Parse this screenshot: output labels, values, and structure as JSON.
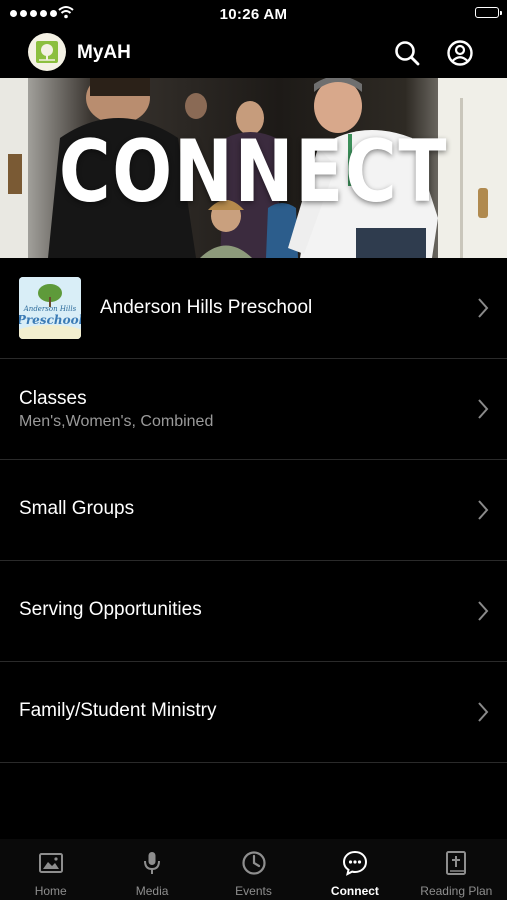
{
  "status_bar": {
    "time": "10:26 AM"
  },
  "nav": {
    "title": "MyAH",
    "logo_icon": "tree-logo-icon",
    "search_icon": "search-icon",
    "account_icon": "account-circle-icon"
  },
  "hero": {
    "title": "CONNECT"
  },
  "list": {
    "items": [
      {
        "title": "Anderson Hills Preschool",
        "thumbnail": "preschool-logo",
        "thumbnail_text": "Anderson Hills",
        "thumbnail_script": "Preschool"
      },
      {
        "title": "Classes",
        "subtitle": "Men's,Women's, Combined"
      },
      {
        "title": "Small Groups"
      },
      {
        "title": "Serving Opportunities"
      },
      {
        "title": "Family/Student Ministry"
      }
    ]
  },
  "tabs": [
    {
      "label": "Home",
      "icon": "image-icon",
      "active": false
    },
    {
      "label": "Media",
      "icon": "microphone-icon",
      "active": false
    },
    {
      "label": "Events",
      "icon": "clock-icon",
      "active": false
    },
    {
      "label": "Connect",
      "icon": "chat-bubble-icon",
      "active": true
    },
    {
      "label": "Reading Plan",
      "icon": "bible-icon",
      "active": false
    }
  ],
  "colors": {
    "background": "#000000",
    "active_tab": "#ffffff",
    "inactive_tab": "#8e8e8e",
    "subtitle": "#9a9a9a"
  }
}
